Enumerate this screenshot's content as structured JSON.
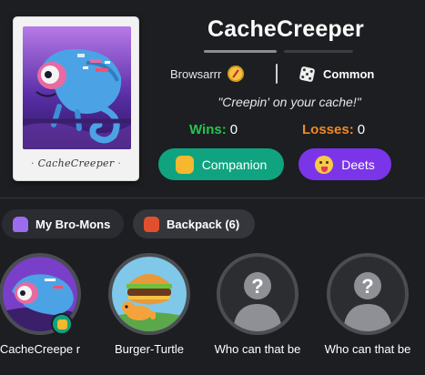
{
  "profile": {
    "name": "CacheCreeper",
    "card_caption": "CacheCreeper",
    "browser": "Browsarrr",
    "browser_icon": "compass-icon",
    "rarity": "Common",
    "rarity_icon": "dice-icon",
    "motto": "\"Creepin' on your cache!\"",
    "wins_label": "Wins:",
    "wins": "0",
    "losses_label": "Losses:",
    "losses": "0"
  },
  "actions": {
    "companion_label": "Companion",
    "companion_icon": "fist-icon",
    "deets_label": "Deets",
    "deets_icon": "tongue-face-icon"
  },
  "tabs": [
    {
      "label": "My Bro-Mons",
      "icon": "alien-monster-icon"
    },
    {
      "label": "Backpack (6)",
      "icon": "backpack-icon"
    }
  ],
  "collection": [
    {
      "label": "CacheCreepe r",
      "icon": "chameleon-avatar",
      "badge": "fist-icon"
    },
    {
      "label": "Burger-Turtle",
      "icon": "burger-turtle-avatar"
    },
    {
      "label": "Who can that be",
      "icon": "mystery-silhouette-icon"
    },
    {
      "label": "Who can that be",
      "icon": "mystery-silhouette-icon"
    }
  ],
  "colors": {
    "background": "#1c1e21",
    "wins": "#23c552",
    "losses": "#f08a24",
    "companion_button": "#10a37f",
    "deets_button": "#7b35e8"
  }
}
